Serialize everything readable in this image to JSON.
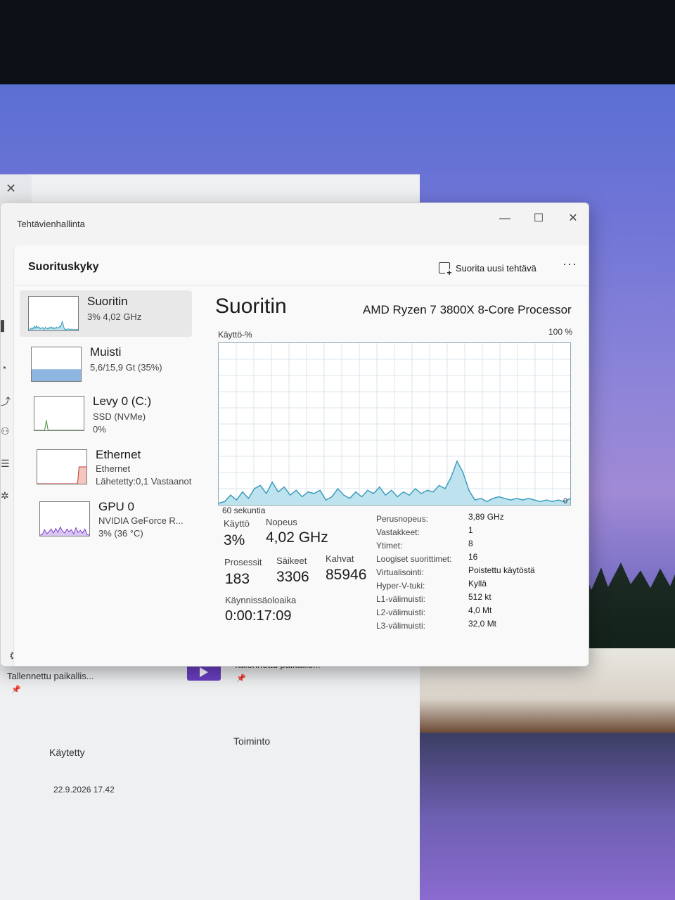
{
  "background_window": {
    "item1_label": "Tallennettu paikallis...",
    "item2_label": "Tallennettu paikallis...",
    "col_used": "Käytetty",
    "col_action": "Toiminto",
    "date": "22.9.2026 17.42"
  },
  "window": {
    "title": "Tehtävienhallinta"
  },
  "header": {
    "page_title": "Suorituskyky",
    "run_task_label": "Suorita uusi tehtävä",
    "more": "···"
  },
  "perf_list": [
    {
      "name": "Suoritin",
      "sub1": "3% 4,02 GHz",
      "sub2": ""
    },
    {
      "name": "Muisti",
      "sub1": "5,6/15,9 Gt (35%)",
      "sub2": ""
    },
    {
      "name": "Levy 0 (C:)",
      "sub1": "SSD (NVMe)",
      "sub2": "0%"
    },
    {
      "name": "Ethernet",
      "sub1": "Ethernet",
      "sub2": "Lähetetty:0,1 Vastaanot"
    },
    {
      "name": "GPU 0",
      "sub1": "NVIDIA GeForce R...",
      "sub2": "3% (36 °C)"
    }
  ],
  "cpu": {
    "title": "Suoritin",
    "model": "AMD Ryzen 7 3800X 8-Core Processor",
    "usage_label": "Käyttö-%",
    "max_label": "100 %",
    "time_label": "60 sekuntia",
    "zero_label": "0",
    "usage_history_percent": [
      1,
      2,
      6,
      3,
      8,
      4,
      10,
      12,
      7,
      14,
      8,
      11,
      6,
      9,
      5,
      8,
      7,
      9,
      3,
      5,
      10,
      6,
      4,
      8,
      5,
      9,
      7,
      11,
      6,
      9,
      5,
      8,
      6,
      10,
      7,
      9,
      8,
      12,
      10,
      17,
      27,
      20,
      9,
      3,
      4,
      2,
      4,
      5,
      4,
      3,
      4,
      3,
      4,
      3,
      2,
      3,
      2,
      3,
      2,
      4
    ],
    "stats": {
      "usage_label": "Käyttö",
      "usage_value": "3%",
      "speed_label": "Nopeus",
      "speed_value": "4,02 GHz",
      "processes_label": "Prosessit",
      "processes_value": "183",
      "threads_label": "Säikeet",
      "threads_value": "3306",
      "handles_label": "Kahvat",
      "handles_value": "85946",
      "uptime_label": "Käynnissäoloaika",
      "uptime_value": "0:00:17:09"
    },
    "specs": [
      {
        "label": "Perusnopeus:",
        "value": "3,89 GHz"
      },
      {
        "label": "Vastakkeet:",
        "value": "1"
      },
      {
        "label": "Ytimet:",
        "value": "8"
      },
      {
        "label": "Loogiset suorittimet:",
        "value": "16"
      },
      {
        "label": "Virtualisointi:",
        "value": "Poistettu käytöstä"
      },
      {
        "label": "Hyper-V-tuki:",
        "value": "Kyllä"
      },
      {
        "label": "L1-välimuisti:",
        "value": "512 kt"
      },
      {
        "label": "L2-välimuisti:",
        "value": "4,0 Mt"
      },
      {
        "label": "L3-välimuisti:",
        "value": "32,0 Mt"
      }
    ]
  },
  "colors": {
    "cpu_line": "#3a9dbd",
    "cpu_fill": "#bfe3ee",
    "memory_fill": "#8fb6e0",
    "ethernet_line": "#c0392b",
    "gpu_line": "#7a3fc7"
  }
}
